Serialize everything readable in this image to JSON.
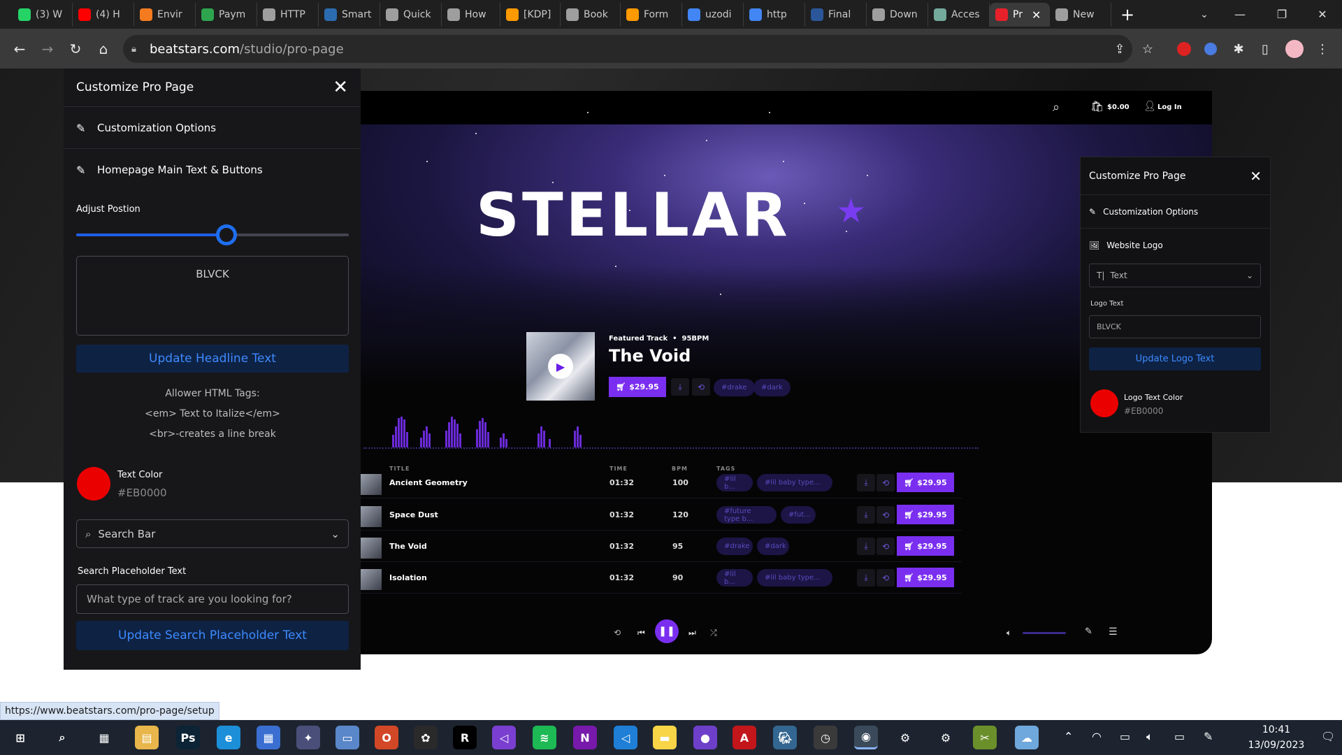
{
  "browser": {
    "tabs": [
      {
        "label": "(3) W",
        "icon": "whatsapp-icon",
        "color": "#25D366"
      },
      {
        "label": "(4) H",
        "icon": "youtube-icon",
        "color": "#FF0000"
      },
      {
        "label": "Envir",
        "icon": "app-icon",
        "color": "#F47B20"
      },
      {
        "label": "Paym",
        "icon": "app-icon",
        "color": "#2EA44F"
      },
      {
        "label": "HTTP",
        "icon": "globe-icon",
        "color": "#9E9E9E"
      },
      {
        "label": "Smart",
        "icon": "app-icon",
        "color": "#2B6CB0"
      },
      {
        "label": "Quick",
        "icon": "globe-icon",
        "color": "#9E9E9E"
      },
      {
        "label": "How",
        "icon": "globe-icon",
        "color": "#9E9E9E"
      },
      {
        "label": "[KDP]",
        "icon": "amazon-icon",
        "color": "#FF9900"
      },
      {
        "label": "Book",
        "icon": "globe-icon",
        "color": "#9E9E9E"
      },
      {
        "label": "Form",
        "icon": "amazon-icon",
        "color": "#FF9900"
      },
      {
        "label": "uzodi",
        "icon": "google-icon",
        "color": "#4285F4"
      },
      {
        "label": "http",
        "icon": "google-icon",
        "color": "#4285F4"
      },
      {
        "label": "Final",
        "icon": "word-icon",
        "color": "#2B579A"
      },
      {
        "label": "Down",
        "icon": "globe-icon",
        "color": "#9E9E9E"
      },
      {
        "label": "Acces",
        "icon": "chatgpt-icon",
        "color": "#74AA9C"
      },
      {
        "label": "Pr",
        "icon": "beatstars-icon",
        "color": "#E8202A",
        "active": true
      },
      {
        "label": "New",
        "icon": "chrome-icon",
        "color": "#9E9E9E"
      }
    ],
    "url_domain": "beatstars.com",
    "url_path": "/studio/pro-page",
    "status_url": "https://www.beatstars.com/pro-page/setup"
  },
  "left_panel": {
    "title": "Customize Pro Page",
    "row1": "Customization Options",
    "row2": "Homepage Main Text & Buttons",
    "adjust_label": "Adjust Postion",
    "slider_value": 0.55,
    "headline_text": "BLVCK",
    "update_headline": "Update Headline Text",
    "allowed_title": "Allower HTML Tags:",
    "allowed_em": "<em> Text to Italize</em>",
    "allowed_br": "<br>-creates a line break",
    "text_color_label": "Text Color",
    "text_color_value": "#EB0000",
    "select_value": "Search Bar",
    "placeholder_label": "Search Placeholder Text",
    "placeholder_value": "What type of track are you looking for?",
    "update_placeholder": "Update Search Placeholder Text"
  },
  "site": {
    "cart": "$0.00",
    "login": "Log In",
    "logo": "STELLAR",
    "featured_meta": "Featured Track  •  95BPM",
    "featured_title": "The Void",
    "featured_price": "$29.95",
    "featured_tags": [
      "#drake",
      "#dark"
    ],
    "headers": {
      "title": "TITLE",
      "time": "TIME",
      "bpm": "BPM",
      "tags": "TAGS"
    },
    "tracks": [
      {
        "title": "Ancient Geometry",
        "time": "01:32",
        "bpm": "100",
        "tag1": "#lil b...",
        "tag2": "#lil baby type...",
        "price": "$29.95"
      },
      {
        "title": "Space Dust",
        "time": "01:32",
        "bpm": "120",
        "tag1": "#future type b...",
        "tag2": "#fut...",
        "price": "$29.95"
      },
      {
        "title": "The Void",
        "time": "01:32",
        "bpm": "95",
        "tag1": "#drake",
        "tag2": "#dark",
        "price": "$29.95"
      },
      {
        "title": "Isolation",
        "time": "01:32",
        "bpm": "90",
        "tag1": "#lil b...",
        "tag2": "#lil baby type...",
        "price": "$29.95"
      }
    ]
  },
  "right_panel": {
    "title": "Customize Pro Page",
    "row1": "Customization Options",
    "row2": "Website Logo",
    "select_value": "Text",
    "logo_text_label": "Logo Text",
    "logo_text_value": "BLVCK",
    "update_logo": "Update Logo Text",
    "logo_color_label": "Logo Text Color",
    "logo_color_value": "#EB0000"
  },
  "taskbar": {
    "time": "10:41",
    "date": "13/09/2023"
  }
}
